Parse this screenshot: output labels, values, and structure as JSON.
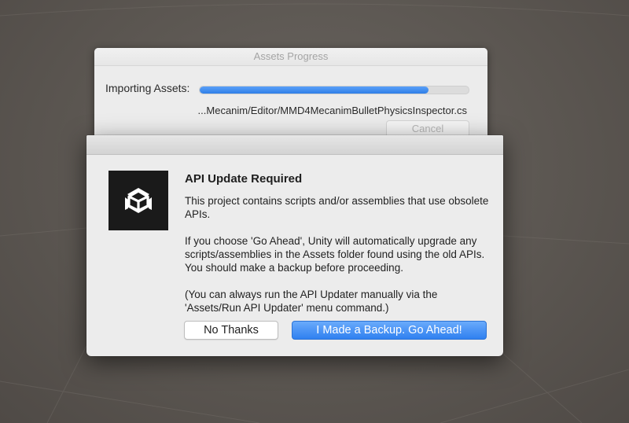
{
  "progress_window": {
    "title": "Assets Progress",
    "label": "Importing Assets:",
    "progress_fraction": 0.85,
    "current_file": "...Mecanim/Editor/MMD4MecanimBulletPhysicsInspector.cs",
    "cancel_label": "Cancel"
  },
  "dialog": {
    "icon": "unity-logo-icon",
    "heading": "API Update Required",
    "paragraphs": [
      "This project contains scripts and/or assemblies that use obsolete APIs.",
      "If you choose 'Go Ahead', Unity will automatically upgrade any scripts/assemblies in the Assets folder found using the old APIs. You should make a backup before proceeding.",
      "(You can always run the API Updater manually via the 'Assets/Run API Updater' menu command.)"
    ],
    "buttons": {
      "secondary_label": "No Thanks",
      "primary_label": "I Made a Backup. Go Ahead!"
    }
  },
  "colors": {
    "accent": "#2f80f0",
    "progress_fill": "#3d8af2",
    "backdrop": "#5c5752"
  }
}
